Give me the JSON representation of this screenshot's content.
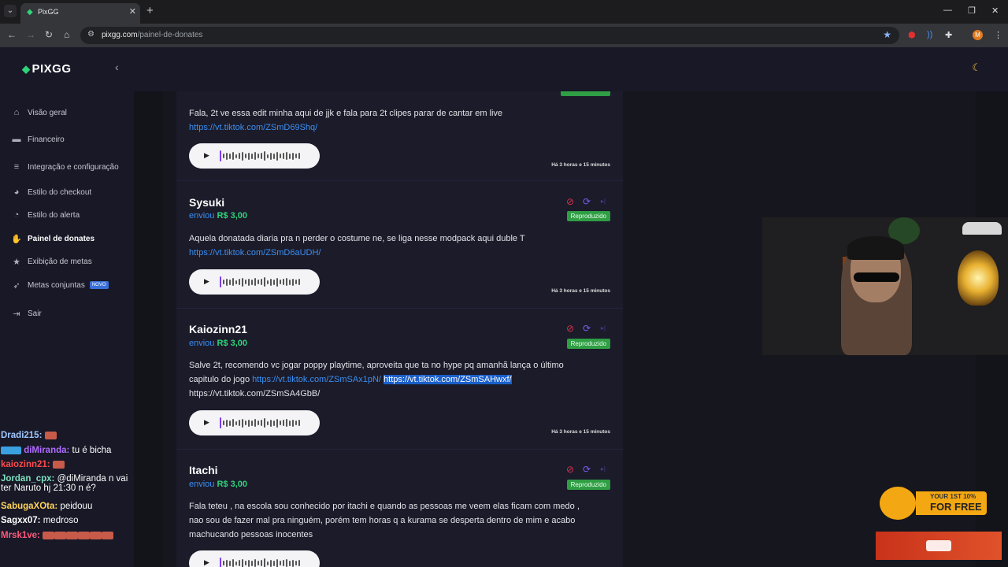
{
  "browser": {
    "tab_title": "PixGG",
    "url_host": "pixgg.com",
    "url_path": "/painel-de-donates",
    "profile_initial": "M"
  },
  "sidebar": {
    "logo": "PIXGG",
    "items": [
      {
        "label": "Visão geral",
        "icon": "home-icon"
      },
      {
        "label": "Financeiro",
        "icon": "wallet-icon"
      },
      {
        "label": "Integração e configuração",
        "icon": "list-icon"
      },
      {
        "label": "Estilo do checkout",
        "icon": "palette-icon"
      },
      {
        "label": "Estilo do alerta",
        "icon": "palette-icon"
      },
      {
        "label": "Painel de donates",
        "icon": "hand-coins-icon"
      },
      {
        "label": "Exibição de metas",
        "icon": "star-icon"
      },
      {
        "label": "Metas conjuntas",
        "icon": "rocket-icon",
        "badge": "NOVO"
      },
      {
        "label": "Sair",
        "icon": "logout-icon"
      }
    ]
  },
  "donations": [
    {
      "message_pre": "Fala, 2t ve essa edit minha aqui de jjk e fala para 2t clipes parar de cantar em live",
      "link1": "https://vt.tiktok.com/ZSmD69Shq/",
      "time": "Há 3 horas e 15 minutos"
    },
    {
      "name": "Sysuki",
      "sent_label": "enviou",
      "amount": "R$ 3,00",
      "status": "Reproduzido",
      "message_pre": "Aquela donatada diaria pra n perder o costume ne, se liga nesse modpack aqui duble T",
      "link1": "https://vt.tiktok.com/ZSmD6aUDH/",
      "time": "Há 3 horas e 15 minutos"
    },
    {
      "name": "Kaiozinn21",
      "sent_label": "enviou",
      "amount": "R$ 3,00",
      "status": "Reproduzido",
      "message_pre": "Salve 2t, recomendo vc jogar poppy playtime, aproveita que ta no hype pq amanhã lança o último capitulo do jogo",
      "link1": "https://vt.tiktok.com/ZSmSAx1pN/",
      "link2": "https://vt.tiktok.com/ZSmSAHwxf/",
      "link3": "https://vt.tiktok.com/ZSmSA4GbB/",
      "time": "Há 3 horas e 15 minutos"
    },
    {
      "name": "Itachi",
      "sent_label": "enviou",
      "amount": "R$ 3,00",
      "status": "Reproduzido",
      "message_pre": "Fala teteu , na escola sou conhecido por itachi e quando as pessoas me veem elas ficam com medo , nao sou de fazer mal pra ninguém, porém tem horas q a kurama se desperta dentro de mim e acabo machucando pessoas inocentes"
    }
  ],
  "chat": [
    {
      "user": "Dradi215:",
      "msg": "",
      "color": "#9ec8ff"
    },
    {
      "user": "diMiranda:",
      "msg": "tu é bicha",
      "color": "#b06cff"
    },
    {
      "user": "kaiozinn21:",
      "msg": "",
      "color": "#ff4a4a"
    },
    {
      "user": "Jordan_cpx:",
      "msg": "@diMiranda n vai ter Naruto hj 21:30 n é?",
      "color": "#7fe3c0"
    },
    {
      "user": "SabugaXOta:",
      "msg": "peidouu",
      "color": "#ffd35a"
    },
    {
      "user": "Sagxx07:",
      "msg": "medroso",
      "color": "#ffffff"
    },
    {
      "user": "Mrsk1ve:",
      "msg": "",
      "color": "#ff5a7a"
    }
  ],
  "promo": {
    "small": "YOUR 1ST 10%",
    "big": "FOR FREE"
  },
  "colors": {
    "accent_green": "#2ed47a",
    "link_blue": "#3b8ff2",
    "status_green": "#2f9e44"
  }
}
